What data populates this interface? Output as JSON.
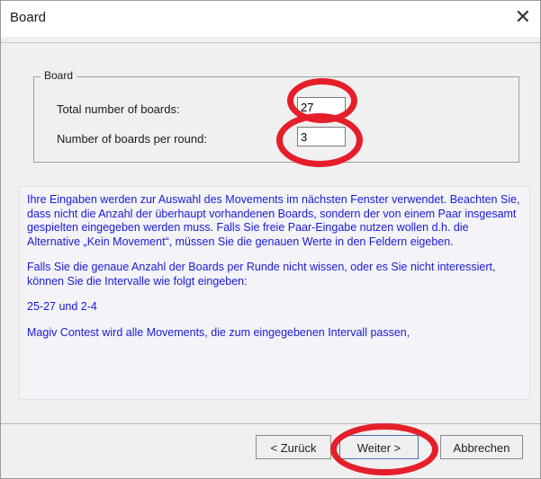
{
  "window": {
    "title": "Board",
    "close_icon": "close-icon"
  },
  "group": {
    "legend": "Board",
    "fields": [
      {
        "label": "Total number of boards:",
        "value": "27"
      },
      {
        "label": "Number of boards per round:",
        "value": "3"
      }
    ]
  },
  "info": {
    "paragraph_1": "Ihre Eingaben werden zur Auswahl des Movements im nächsten Fenster verwendet. Beachten Sie, dass nicht die Anzahl der überhaupt vorhandenen Boards, sondern der von einem Paar insgesamt gespielten eingegeben werden muss. Falls Sie freie Paar-Eingabe nutzen wollen d.h. die Alternative „Kein Movement“, müssen Sie die genauen Werte in den Feldern eigeben.",
    "paragraph_2": "Falls Sie die genaue Anzahl der Boards per Runde nicht wissen, oder es Sie nicht interessiert, können Sie die Intervalle wie folgt eingeben:",
    "paragraph_3": "25-27 und 2-4",
    "paragraph_4": "Magiv Contest wird alle Movements, die zum eingegebenen Intervall passen,"
  },
  "buttons": {
    "back": "< Zurück",
    "next": "Weiter >",
    "cancel": "Abbrechen"
  },
  "colors": {
    "info_text": "#1a1ad8",
    "highlight_marker": "#e51f2a"
  }
}
